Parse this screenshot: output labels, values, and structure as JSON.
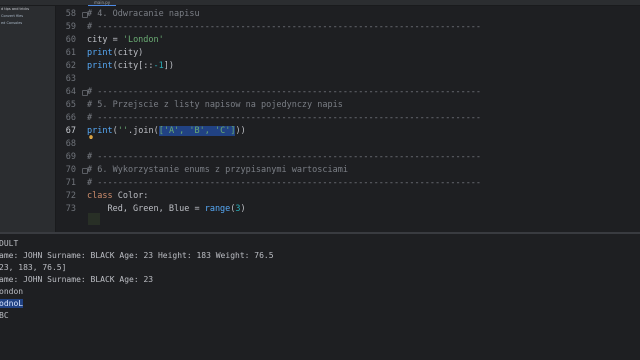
{
  "tab": {
    "label": "main.py"
  },
  "project": {
    "items": [
      "d tips and tricks",
      "Convert files",
      "ed Consoles"
    ]
  },
  "editor": {
    "lines": [
      {
        "n": "58",
        "text": "# 4. Odwracanie napisu"
      },
      {
        "n": "59",
        "text": "# ---------------------------------------------------------------------------"
      },
      {
        "n": "60",
        "p": [
          "city = ",
          "'London'"
        ]
      },
      {
        "n": "61",
        "p": [
          "print",
          "(city)"
        ]
      },
      {
        "n": "62",
        "p": [
          "print",
          "(city[::",
          "-1",
          "])"
        ]
      },
      {
        "n": "63",
        "text": ""
      },
      {
        "n": "64",
        "text": "# ---------------------------------------------------------------------------"
      },
      {
        "n": "65",
        "text": "# 5. Przejscie z listy napisow na pojedynczy napis"
      },
      {
        "n": "66",
        "text": "# ---------------------------------------------------------------------------"
      },
      {
        "n": "67",
        "p": [
          "print",
          "(",
          "''",
          ".",
          "join",
          "(",
          "['A', 'B', 'C']",
          "))"
        ]
      },
      {
        "n": "68",
        "text": ""
      },
      {
        "n": "69",
        "text": "# ---------------------------------------------------------------------------"
      },
      {
        "n": "70",
        "text": "# 6. Wykorzystanie enums z przypisanymi wartosciami"
      },
      {
        "n": "71",
        "text": "# ---------------------------------------------------------------------------"
      },
      {
        "n": "72",
        "p": [
          "class ",
          "Color:"
        ]
      },
      {
        "n": "73",
        "p": [
          "    Red, Green, Blue = ",
          "range",
          "(",
          "3",
          ")"
        ]
      }
    ]
  },
  "console": {
    "lines": [
      "DULT",
      "ame: JOHN Surname: BLACK Age: 23 Height: 183 Weight: 76.5",
      "23, 183, 76.5]",
      "ame: JOHN Surname: BLACK Age: 23",
      "ondon",
      "odnoL",
      "BC"
    ]
  },
  "colors": {
    "background": "#1e1f22",
    "selection": "#214283",
    "comment": "#7a7e85",
    "keyword": "#cf8e6d",
    "string": "#6aab73",
    "number": "#2aacb8"
  }
}
